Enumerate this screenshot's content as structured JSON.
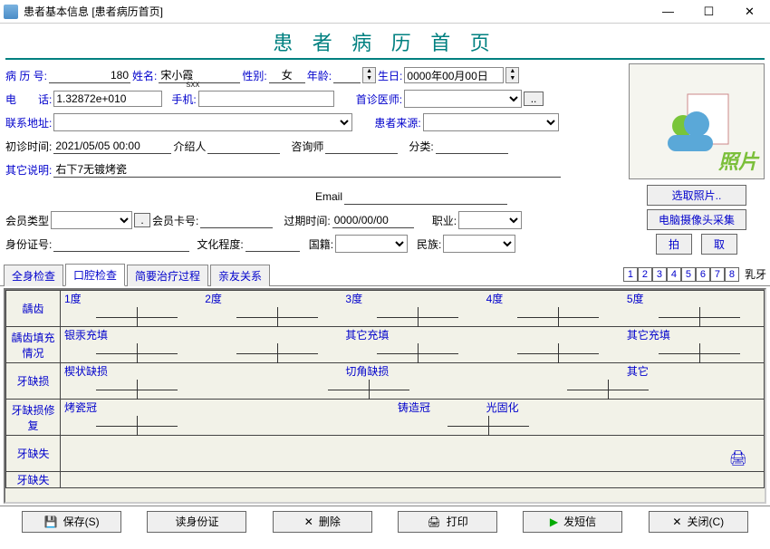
{
  "window": {
    "title": "患者基本信息   [患者病历首页]"
  },
  "page_title": "患 者 病 历 首 页",
  "labels": {
    "record_no": "病 历 号:",
    "name": "姓名:",
    "gender": "性别:",
    "age": "年龄:",
    "birthday": "生日:",
    "phone": "电　　话:",
    "mobile": "手机:",
    "first_doctor": "首诊医师:",
    "address": "联系地址:",
    "source": "患者来源:",
    "first_visit": "初诊时间:",
    "referrer": "介绍人",
    "consultant": "咨询师",
    "category": "分类:",
    "other_note": "其它说明:",
    "email": "Email",
    "member_type": "会员类型",
    "member_card": "会员卡号:",
    "expire": "过期时间:",
    "job": "职业:",
    "idcard": "身份证号:",
    "education": "文化程度:",
    "nationality": "国籍:",
    "ethnic": "民族:",
    "photo": "照片",
    "pinyin": "sxx",
    "milk_tooth": "乳牙"
  },
  "values": {
    "record_no": "180",
    "name": "宋小霞",
    "gender": "女",
    "age": "",
    "birthday": "0000年00月00日",
    "phone": "1.32872e+010",
    "mobile": "",
    "first_doctor": "",
    "address": "",
    "source": "",
    "first_visit": "2021/05/05 00:00",
    "referrer": "",
    "consultant": "",
    "category": "",
    "other_note": "右下7无镀烤瓷",
    "email": "",
    "member_type": "",
    "member_card": "",
    "expire": "0000/00/00",
    "job": "",
    "idcard": "",
    "education": "",
    "nationality": "",
    "ethnic": ""
  },
  "side_buttons": {
    "select_photo": "选取照片..",
    "camera": "电脑摄像头采集",
    "take": "拍",
    "get": "取"
  },
  "tabs": [
    "全身检查",
    "口腔检查",
    "简要治疗过程",
    "亲友关系"
  ],
  "active_tab": 1,
  "tooth_numbers": [
    "1",
    "2",
    "3",
    "4",
    "5",
    "6",
    "7",
    "8"
  ],
  "grid": {
    "row_headers": [
      "龋齿",
      "龋齿填充情况",
      "牙缺损",
      "牙缺损修  复",
      "牙缺失",
      "牙缺失"
    ],
    "row0": [
      "1度",
      "2度",
      "3度",
      "4度",
      "5度"
    ],
    "row1": [
      "银汞充填",
      "",
      "其它充填",
      "",
      "其它充填"
    ],
    "row2": [
      "楔状缺损",
      "",
      "切角缺损",
      "",
      "其它"
    ],
    "row3": [
      "烤瓷冠",
      "",
      "铸造冠",
      "光固化",
      ""
    ],
    "row4": [
      "",
      "",
      "",
      "",
      ""
    ]
  },
  "bottom_buttons": {
    "save": "保存(S)",
    "read_id": "读身份证",
    "delete": "删除",
    "print": "打印",
    "sms": "发短信",
    "close": "关闭(C)"
  }
}
